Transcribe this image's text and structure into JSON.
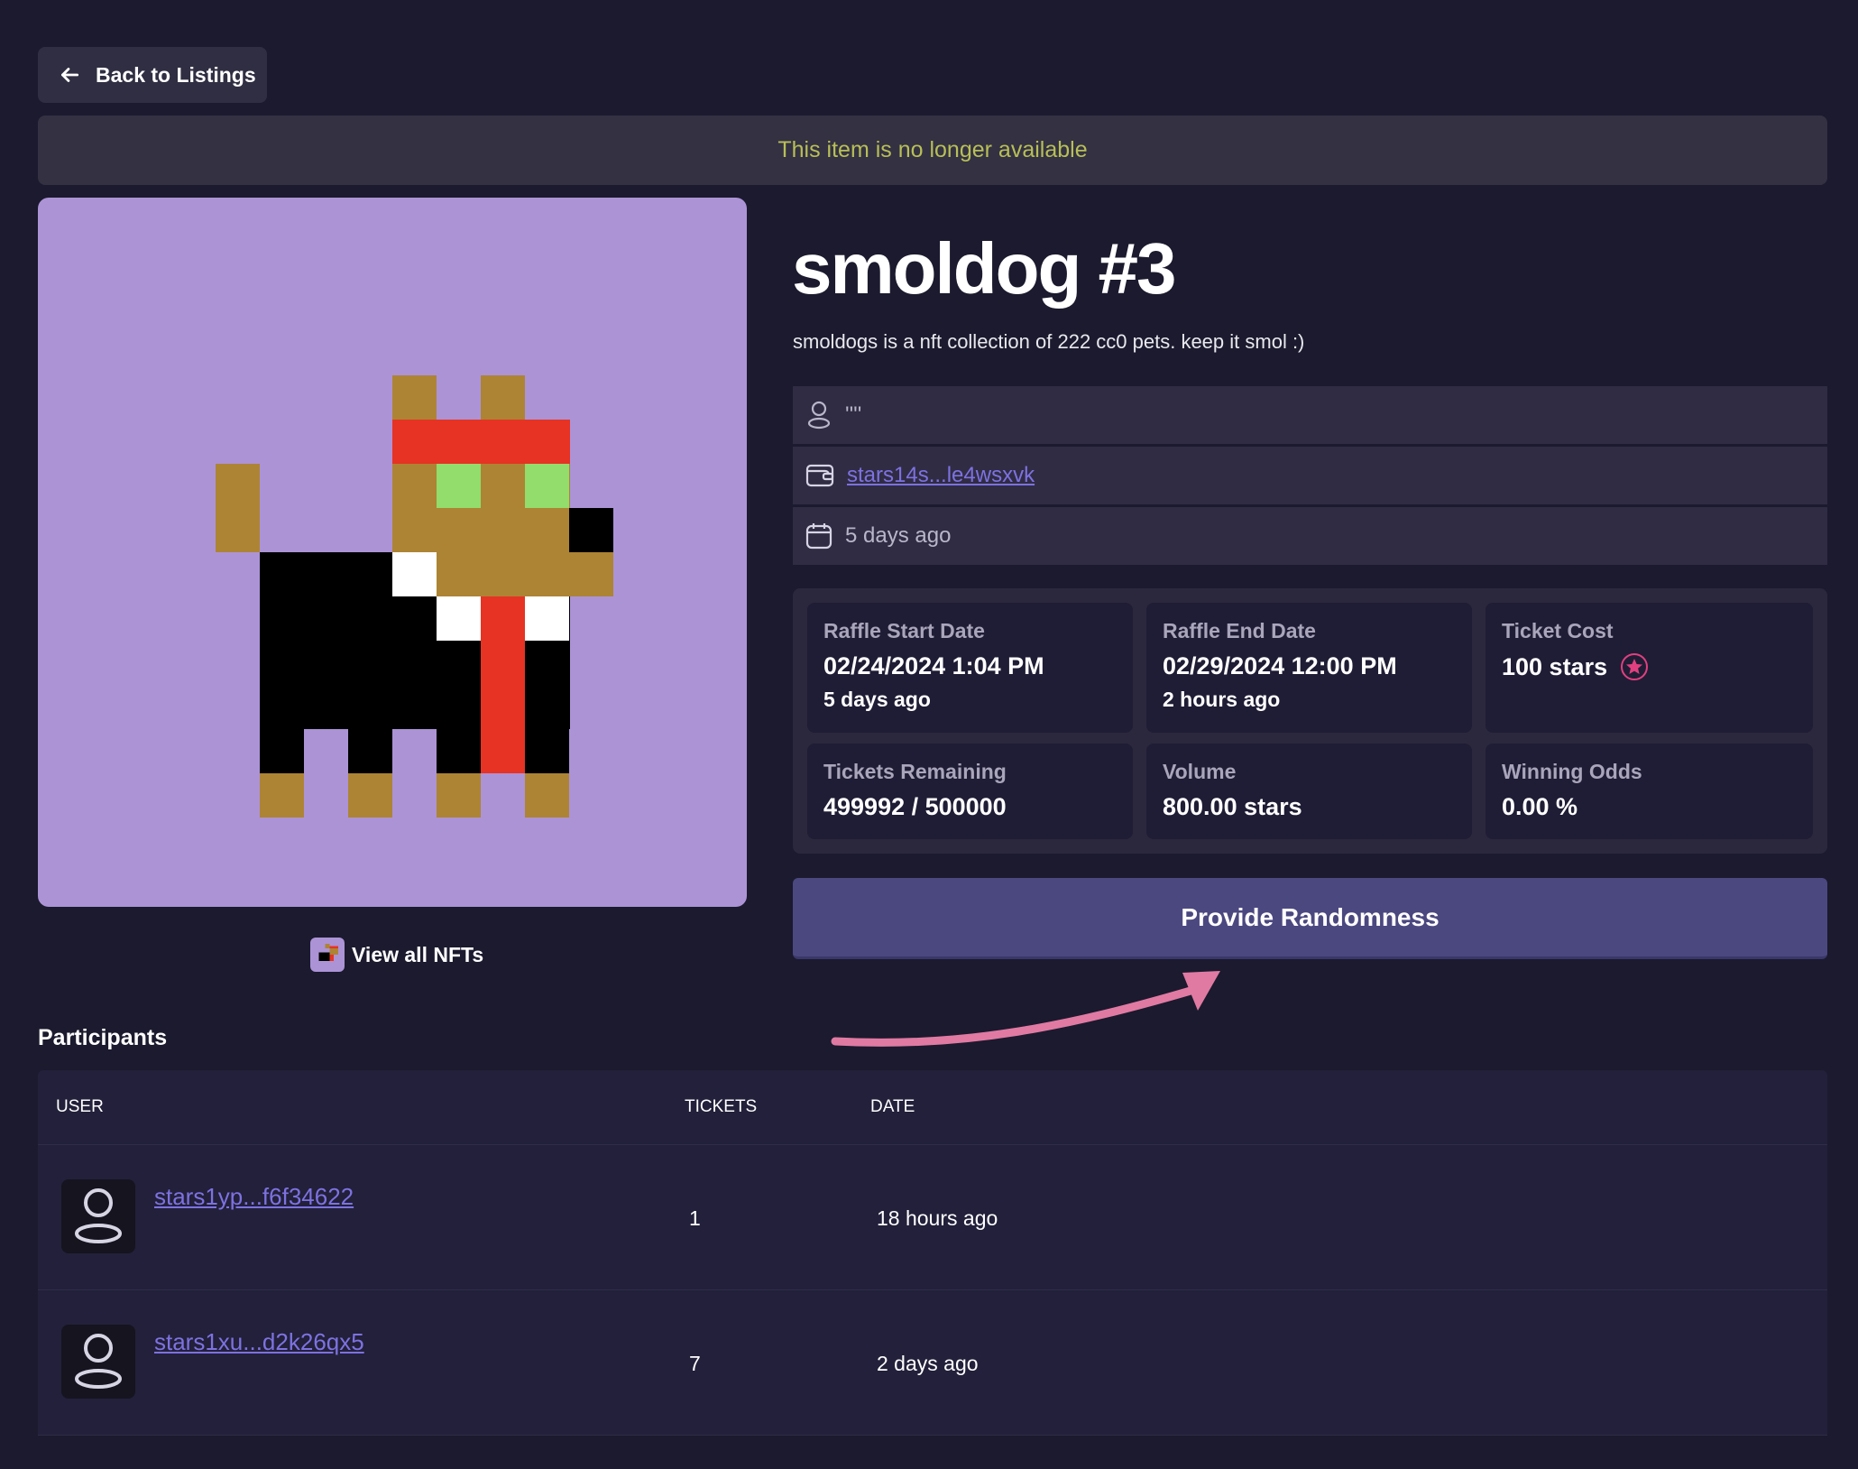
{
  "nav": {
    "back_label": "Back to Listings"
  },
  "banner": {
    "message": "This item is no longer available"
  },
  "nft": {
    "title": "smoldog #3",
    "description": "smoldogs is a nft collection of 222 cc0 pets. keep it smol :)",
    "view_all_label": "View all NFTs"
  },
  "meta": {
    "owner_name": "''''",
    "wallet": "stars14s...le4wsxvk",
    "listed": "5 days ago"
  },
  "stats": {
    "start_label": "Raffle Start Date",
    "start_value": "02/24/2024 1:04 PM",
    "start_sub": "5 days ago",
    "end_label": "Raffle End Date",
    "end_value": "02/29/2024 12:00 PM",
    "end_sub": "2 hours ago",
    "cost_label": "Ticket Cost",
    "cost_value": "100 stars",
    "remaining_label": "Tickets Remaining",
    "remaining_value": "499992 / 500000",
    "volume_label": "Volume",
    "volume_value": "800.00 stars",
    "odds_label": "Winning Odds",
    "odds_value": "0.00 %"
  },
  "cta": {
    "label": "Provide Randomness"
  },
  "participants": {
    "title": "Participants",
    "columns": [
      "USER",
      "TICKETS",
      "DATE"
    ],
    "rows": [
      {
        "user": "stars1yp...f6f34622",
        "tickets": "1",
        "date": "18 hours ago"
      },
      {
        "user": "stars1xu...d2k26qx5",
        "tickets": "7",
        "date": "2 days ago"
      }
    ]
  },
  "colors": {
    "background": "#1b1a2e",
    "accent_link": "#7d72e0",
    "banner_text": "#b8bf57",
    "nft_background": "#ac93d6",
    "cta_button": "#4b4880",
    "annotation_arrow": "#e07aa3"
  }
}
